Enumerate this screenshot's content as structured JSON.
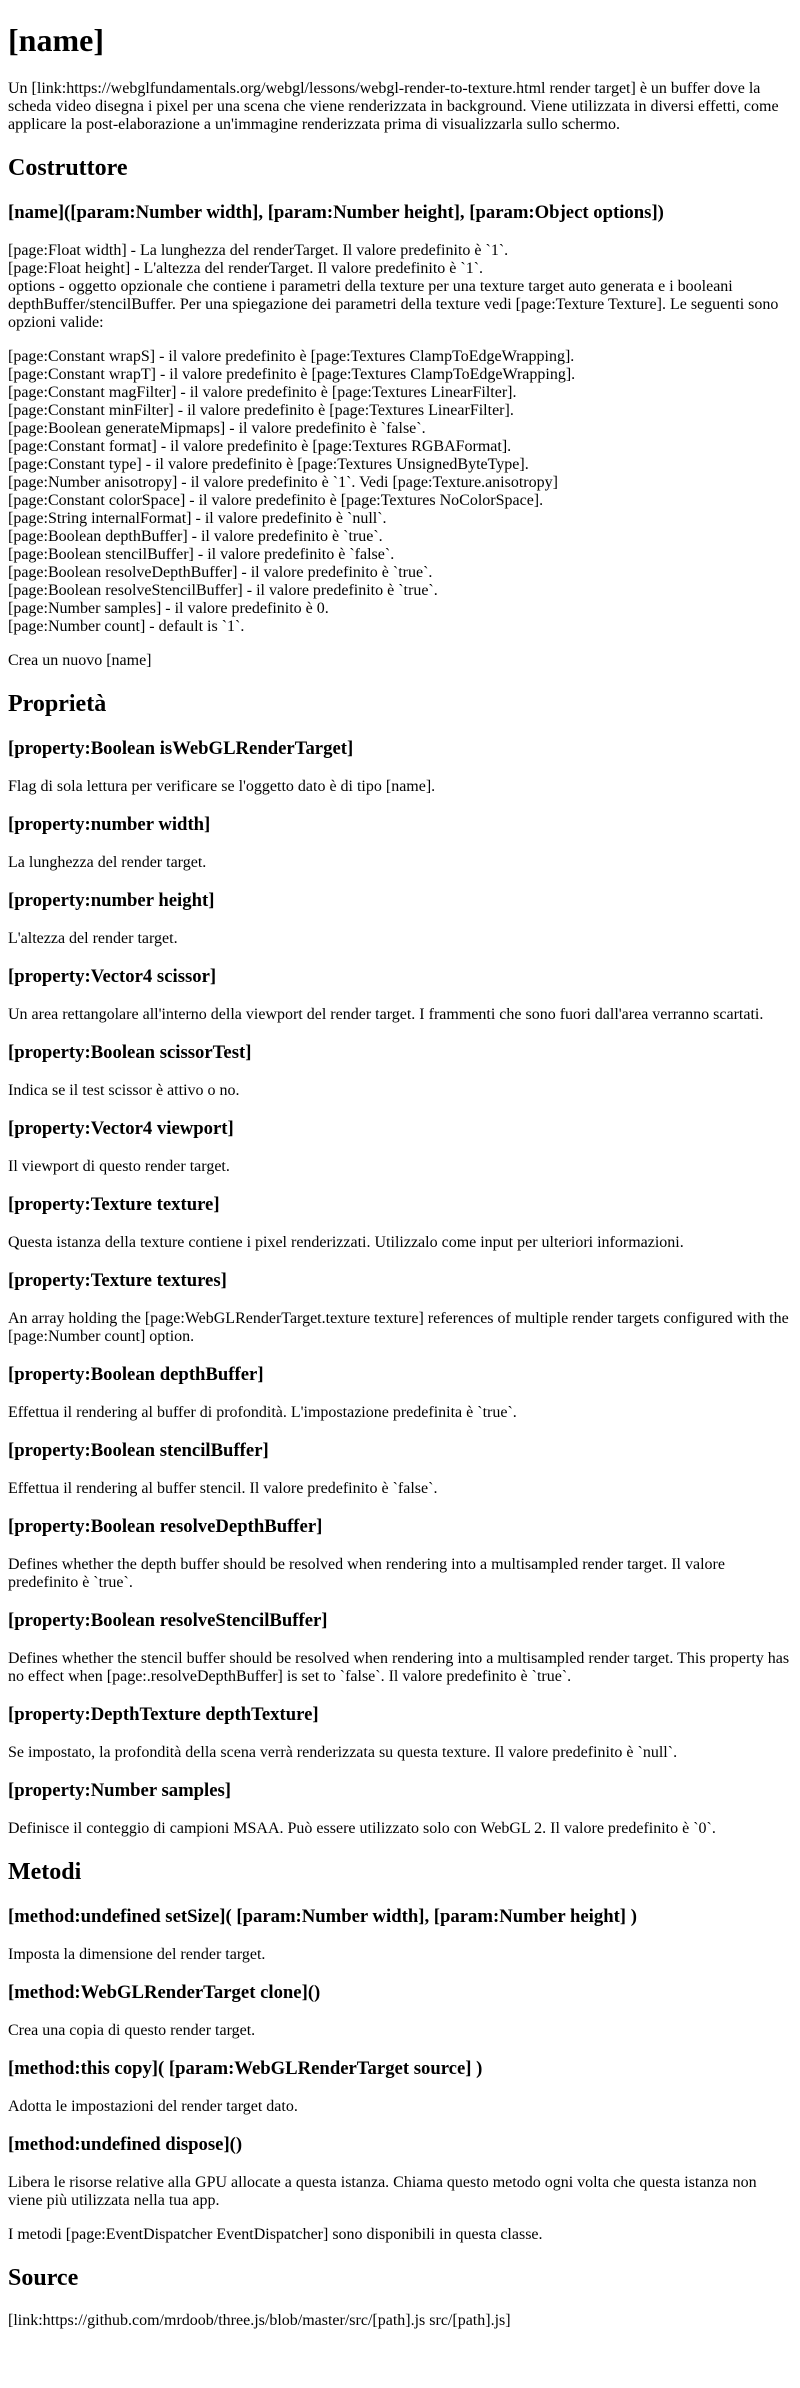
{
  "title": "[name]",
  "intro": "Un [link:https://webglfundamentals.org/webgl/lessons/webgl-render-to-texture.html render target] è un buffer dove la scheda video disegna i pixel per una scena che viene renderizzata in background. Viene utilizzata in diversi effetti, come applicare la post-elaborazione a un'immagine renderizzata prima di visualizzarla sullo schermo.",
  "constructor_section": {
    "heading": "Costruttore",
    "signature": "[name]([param:Number width], [param:Number height], [param:Object options])",
    "params": [
      "[page:Float width] - La lunghezza del renderTarget. Il valore predefinito è `1`.",
      "[page:Float height] - L'altezza del renderTarget. Il valore predefinito è `1`.",
      "options - oggetto opzionale che contiene i parametri della texture per una texture target auto generata e i booleani depthBuffer/stencilBuffer. Per una spiegazione dei parametri della texture vedi [page:Texture Texture]. Le seguenti sono opzioni valide:"
    ],
    "options": [
      "[page:Constant wrapS] - il valore predefinito è [page:Textures ClampToEdgeWrapping].",
      "[page:Constant wrapT] - il valore predefinito è [page:Textures ClampToEdgeWrapping].",
      "[page:Constant magFilter] - il valore predefinito è [page:Textures LinearFilter].",
      "[page:Constant minFilter] - il valore predefinito è [page:Textures LinearFilter].",
      "[page:Boolean generateMipmaps] - il valore predefinito è `false`.",
      "[page:Constant format] - il valore predefinito è [page:Textures RGBAFormat].",
      "[page:Constant type] - il valore predefinito è [page:Textures UnsignedByteType].",
      "[page:Number anisotropy] - il valore predefinito è `1`. Vedi [page:Texture.anisotropy]",
      "[page:Constant colorSpace] - il valore predefinito è [page:Textures NoColorSpace].",
      "[page:String internalFormat] - il valore predefinito è `null`.",
      "[page:Boolean depthBuffer] - il valore predefinito è `true`.",
      "[page:Boolean stencilBuffer] - il valore predefinito è `false`.",
      "[page:Boolean resolveDepthBuffer] - il valore predefinito è `true`.",
      "[page:Boolean resolveStencilBuffer] - il valore predefinito è `true`.",
      "[page:Number samples] - il valore predefinito è 0.",
      "[page:Number count] - default is `1`."
    ],
    "footer": "Crea un nuovo [name]"
  },
  "properties_section": {
    "heading": "Proprietà",
    "items": [
      {
        "name": "[property:Boolean isWebGLRenderTarget]",
        "desc": "Flag di sola lettura per verificare se l'oggetto dato è di tipo [name]."
      },
      {
        "name": "[property:number width]",
        "desc": "La lunghezza del render target."
      },
      {
        "name": "[property:number height]",
        "desc": "L'altezza del render target."
      },
      {
        "name": "[property:Vector4 scissor]",
        "desc": "Un area rettangolare all'interno della viewport del render target. I frammenti che sono fuori dall'area verranno scartati."
      },
      {
        "name": "[property:Boolean scissorTest]",
        "desc": "Indica se il test scissor è attivo o no."
      },
      {
        "name": "[property:Vector4 viewport]",
        "desc": "Il viewport di questo render target."
      },
      {
        "name": "[property:Texture texture]",
        "desc": "Questa istanza della texture contiene i pixel renderizzati. Utilizzalo come input per ulteriori informazioni."
      },
      {
        "name": "[property:Texture textures]",
        "desc": "An array holding the [page:WebGLRenderTarget.texture texture] references of multiple render targets configured with the [page:Number count] option."
      },
      {
        "name": "[property:Boolean depthBuffer]",
        "desc": "Effettua il rendering al buffer di profondità. L'impostazione predefinita è `true`."
      },
      {
        "name": "[property:Boolean stencilBuffer]",
        "desc": "Effettua il rendering al buffer stencil. Il valore predefinito è `false`."
      },
      {
        "name": "[property:Boolean resolveDepthBuffer]",
        "desc": "Defines whether the depth buffer should be resolved when rendering into a multisampled render target. Il valore predefinito è `true`."
      },
      {
        "name": "[property:Boolean resolveStencilBuffer]",
        "desc": "Defines whether the stencil buffer should be resolved when rendering into a multisampled render target. This property has no effect when [page:.resolveDepthBuffer] is set to `false`. Il valore predefinito è `true`."
      },
      {
        "name": "[property:DepthTexture depthTexture]",
        "desc": "Se impostato, la profondità della scena verrà renderizzata su questa texture. Il valore predefinito è `null`."
      },
      {
        "name": "[property:Number samples]",
        "desc": "Definisce il conteggio di campioni MSAA. Può essere utilizzato solo con WebGL 2. Il valore predefinito è `0`."
      }
    ]
  },
  "methods_section": {
    "heading": "Metodi",
    "items": [
      {
        "name": "[method:undefined setSize]( [param:Number width], [param:Number height] )",
        "desc": "Imposta la dimensione del render target."
      },
      {
        "name": "[method:WebGLRenderTarget clone]()",
        "desc": "Crea una copia di questo render target."
      },
      {
        "name": "[method:this copy]( [param:WebGLRenderTarget source] )",
        "desc": "Adotta le impostazioni del render target dato."
      },
      {
        "name": "[method:undefined dispose]()",
        "desc": "Libera le risorse relative alla GPU allocate a questa istanza. Chiama questo metodo ogni volta che questa istanza non viene più utilizzata nella tua app."
      }
    ],
    "footer": "I metodi [page:EventDispatcher EventDispatcher] sono disponibili in questa classe."
  },
  "source_section": {
    "heading": "Source",
    "text": "[link:https://github.com/mrdoob/three.js/blob/master/src/[path].js src/[path].js]"
  }
}
